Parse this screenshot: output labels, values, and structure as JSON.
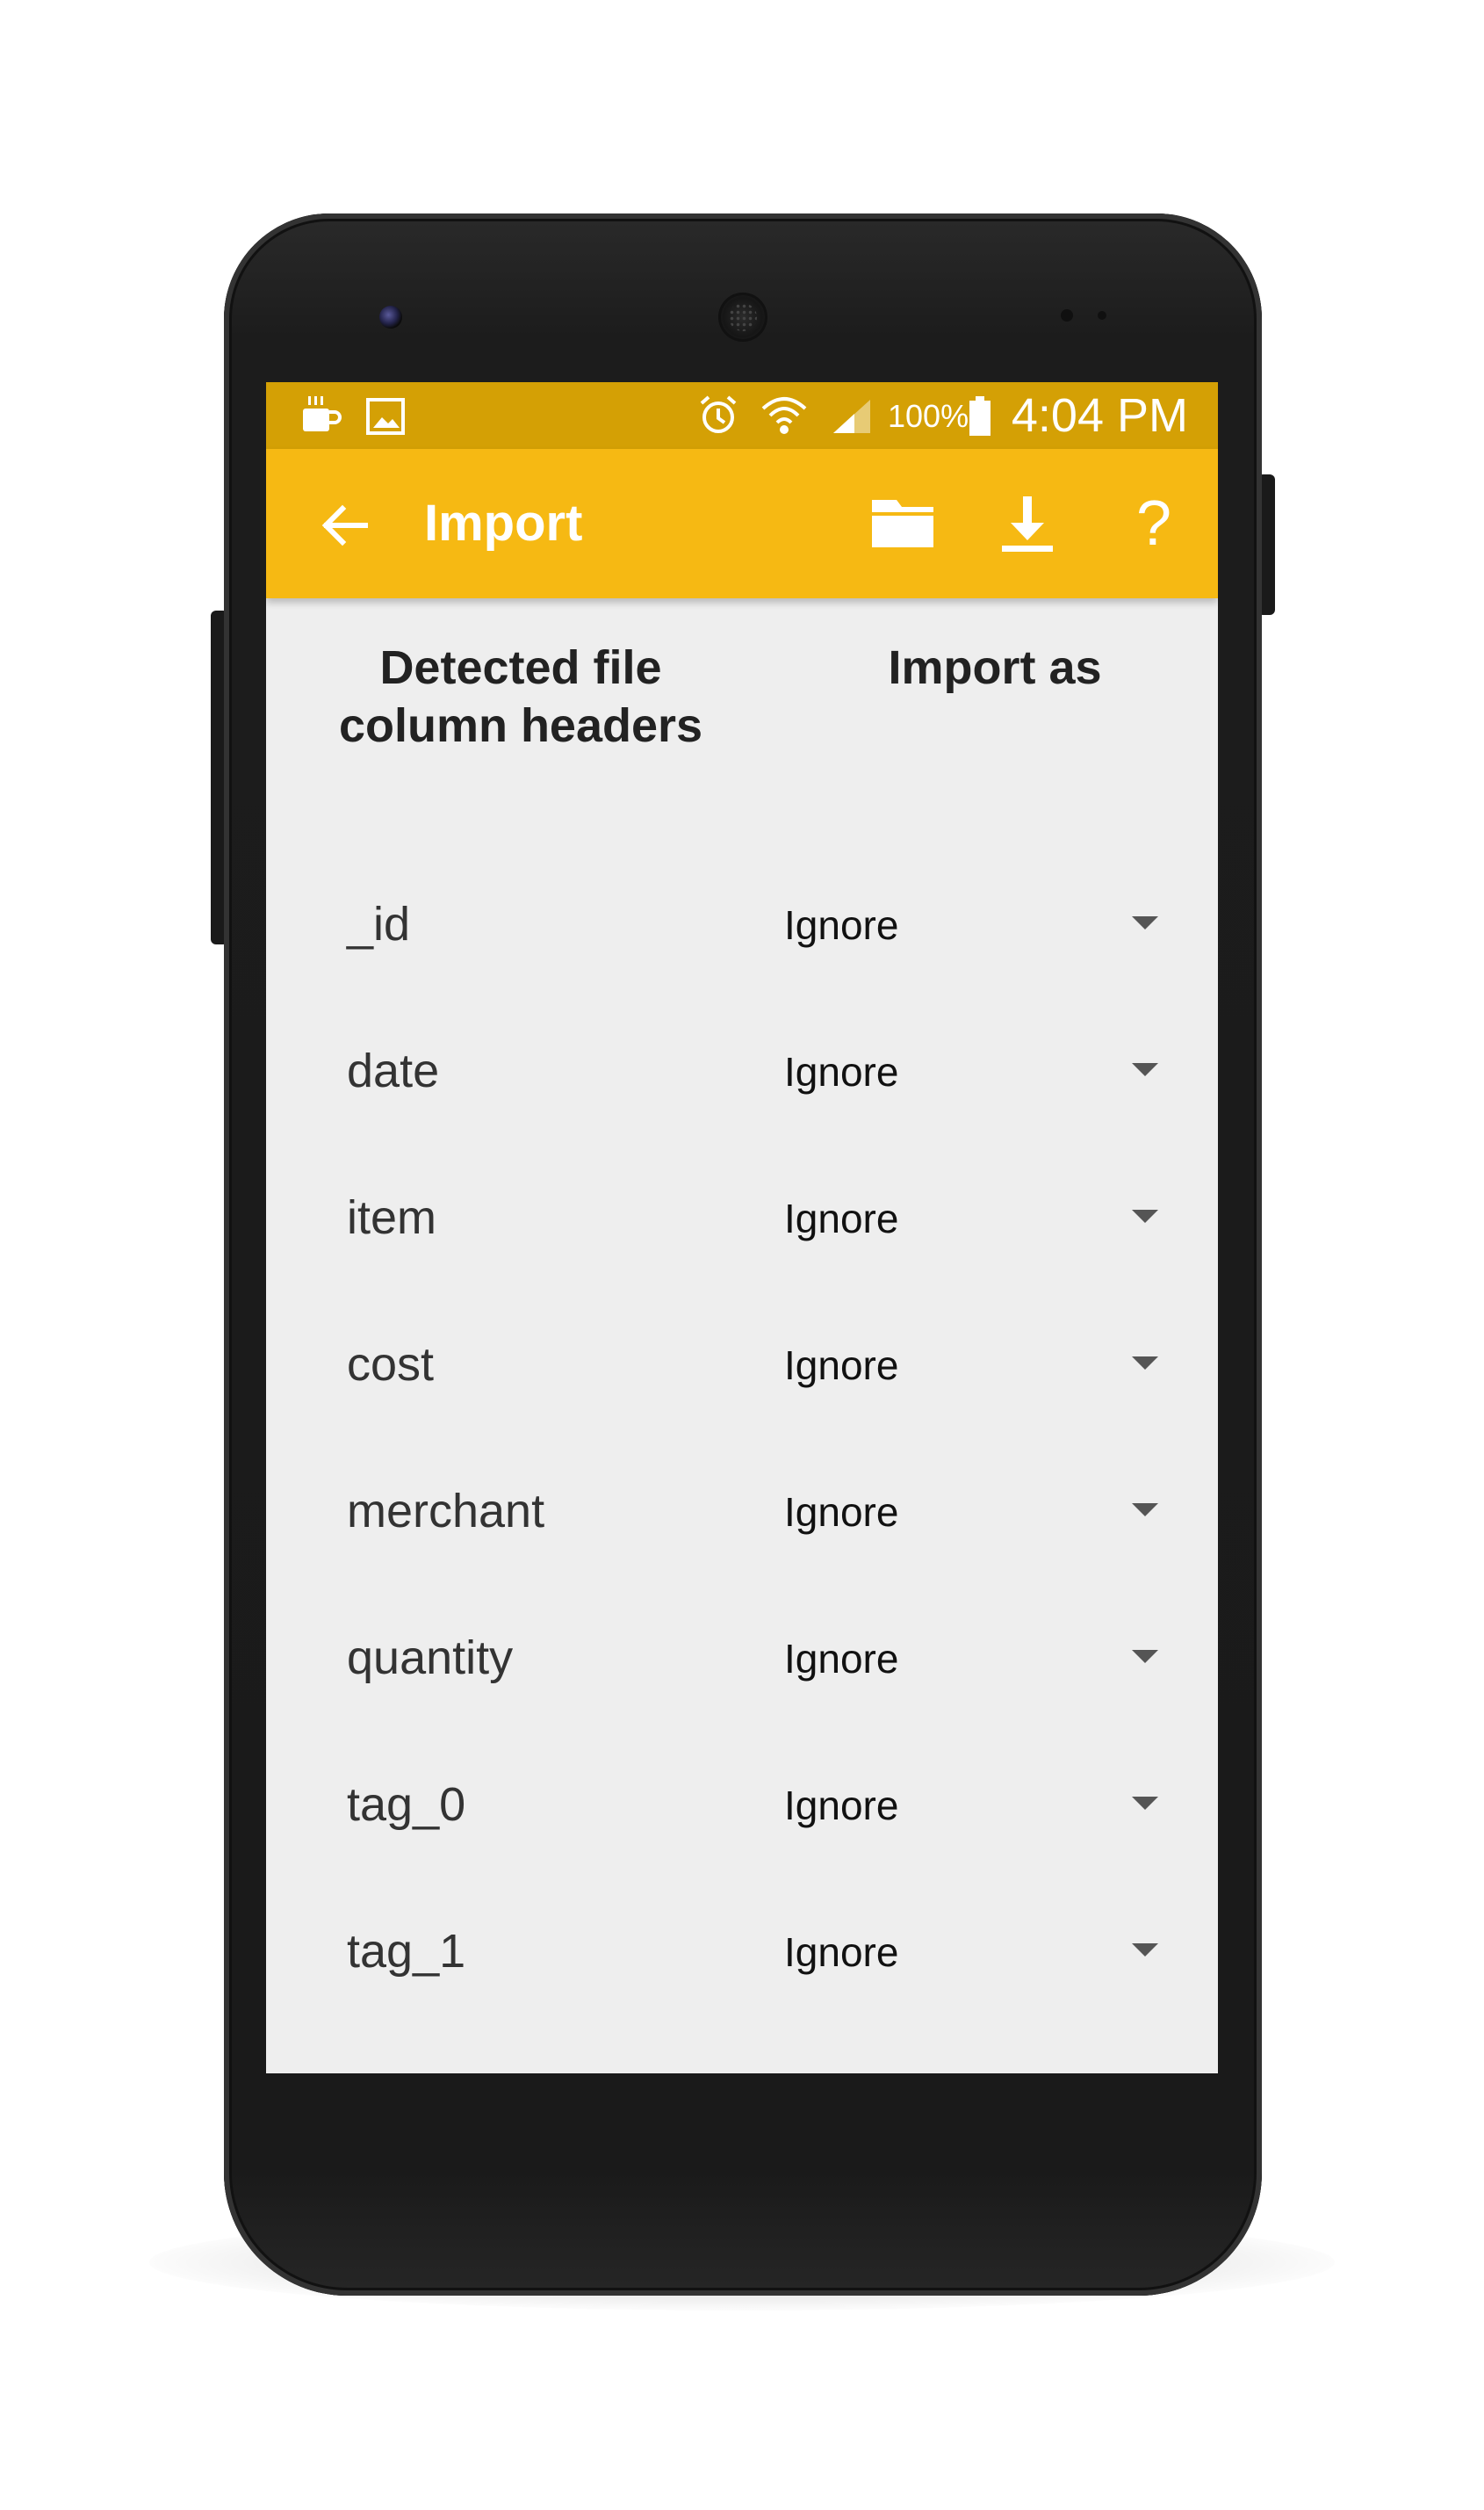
{
  "status_bar": {
    "icons": [
      "coffee-icon",
      "image-icon",
      "alarm-icon",
      "wifi-icon",
      "signal-icon",
      "battery-icon"
    ],
    "battery_percent": "100%",
    "time": "4:04 PM"
  },
  "toolbar": {
    "title": "Import",
    "icons": [
      "back-arrow-icon",
      "folder-icon",
      "download-icon",
      "help-icon"
    ],
    "help_label": "?"
  },
  "columns": {
    "left_header": "Detected file column headers",
    "right_header": "Import as"
  },
  "rows": [
    {
      "name": "_id",
      "import_as": "Ignore"
    },
    {
      "name": "date",
      "import_as": "Ignore"
    },
    {
      "name": "item",
      "import_as": "Ignore"
    },
    {
      "name": "cost",
      "import_as": "Ignore"
    },
    {
      "name": "merchant",
      "import_as": "Ignore"
    },
    {
      "name": "quantity",
      "import_as": "Ignore"
    },
    {
      "name": "tag_0",
      "import_as": "Ignore"
    },
    {
      "name": "tag_1",
      "import_as": "Ignore"
    }
  ],
  "colors": {
    "status_bar": "#d4a005",
    "toolbar": "#f6b913",
    "content_background": "#eeeeee",
    "phone_body": "#1c1c1c"
  }
}
